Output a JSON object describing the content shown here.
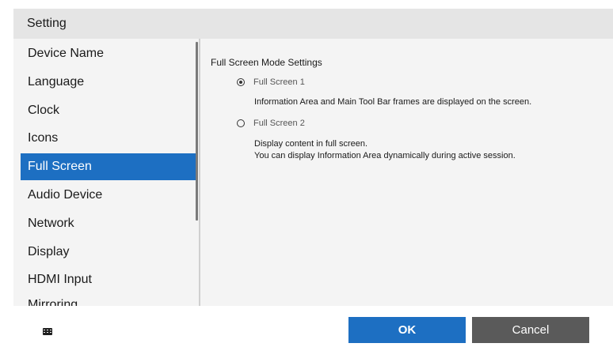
{
  "dialog": {
    "title": "Setting"
  },
  "sidebar": {
    "items": [
      {
        "label": "Device Name",
        "selected": false
      },
      {
        "label": "Language",
        "selected": false
      },
      {
        "label": "Clock",
        "selected": false
      },
      {
        "label": "Icons",
        "selected": false
      },
      {
        "label": "Full Screen",
        "selected": true
      },
      {
        "label": "Audio Device",
        "selected": false
      },
      {
        "label": "Network",
        "selected": false
      },
      {
        "label": "Display",
        "selected": false
      },
      {
        "label": "HDMI Input",
        "selected": false
      },
      {
        "label": "Mirroring",
        "selected": false
      }
    ]
  },
  "content": {
    "section_title": "Full Screen Mode Settings",
    "options": [
      {
        "label": "Full Screen 1",
        "checked": true,
        "description": [
          "Information Area and Main Tool Bar frames are displayed on the screen."
        ]
      },
      {
        "label": "Full Screen 2",
        "checked": false,
        "description": [
          "Display content in full screen.",
          "You can display Information Area dynamically during active session."
        ]
      }
    ]
  },
  "footer": {
    "keyboard_icon": "keyboard-icon",
    "ok_label": "OK",
    "cancel_label": "Cancel"
  },
  "colors": {
    "accent": "#1d6fc2",
    "cancel_button": "#5a5a5a",
    "title_bar": "#e5e5e5",
    "panel_background": "#f4f4f4"
  }
}
